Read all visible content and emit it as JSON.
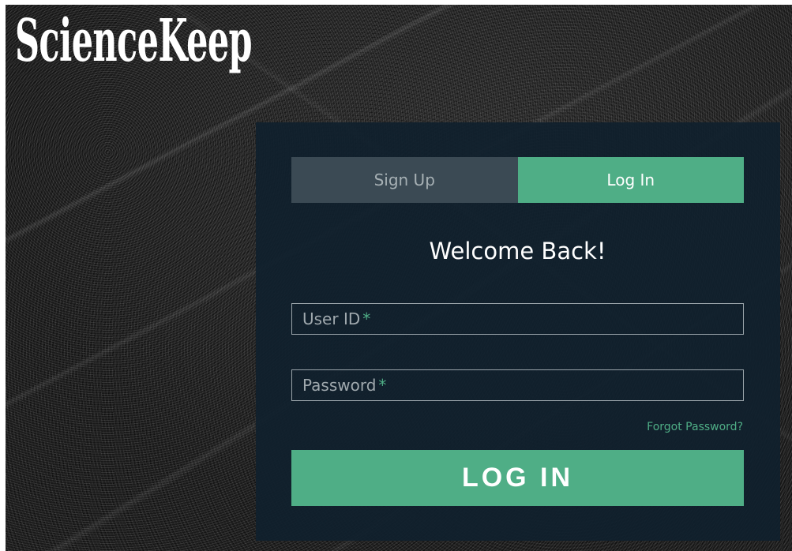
{
  "brand": {
    "logo_text": "ScienceKeep"
  },
  "auth_card": {
    "tabs": [
      {
        "label": "Sign Up",
        "active": false
      },
      {
        "label": "Log In",
        "active": true
      }
    ],
    "heading": "Welcome Back!",
    "fields": {
      "user_id": {
        "label": "User ID",
        "required_mark": "*",
        "value": ""
      },
      "password": {
        "label": "Password",
        "required_mark": "*",
        "value": ""
      }
    },
    "forgot_password_label": "Forgot Password?",
    "submit_label": "LOG IN"
  },
  "colors": {
    "accent": "#4fae86",
    "card_background": "#10202d",
    "inactive_tab": "#3b4a54"
  }
}
